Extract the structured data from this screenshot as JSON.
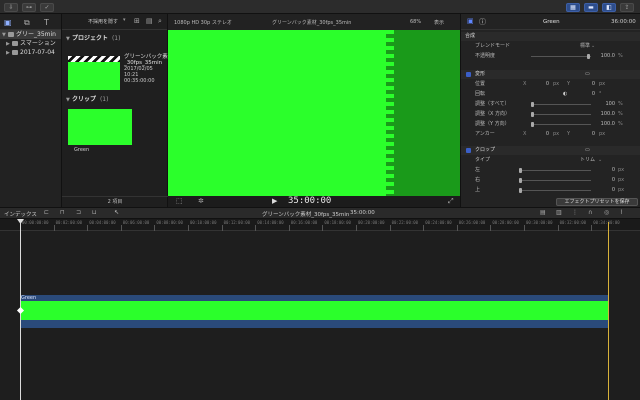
{
  "library": {
    "items": [
      {
        "label": "グリー_35min",
        "selected": true
      },
      {
        "label": "スマーション",
        "selected": false
      },
      {
        "label": "2017-07-04",
        "selected": false
      }
    ]
  },
  "browser": {
    "filter_label": "不採用を隠す",
    "project_section": {
      "title": "プロジェクト",
      "count": "(1)"
    },
    "project": {
      "name": "グリーンバック素_30fps_35min",
      "date": "2017/02/05 10:21",
      "duration": "00:35:00:00"
    },
    "clip_section": {
      "title": "クリップ",
      "count": "(1)"
    },
    "clip_name": "Green",
    "footer": "2 項目"
  },
  "viewer": {
    "format": "1080p HD 30p ステレオ",
    "project_name": "グリーンバック素材_30fps_35min",
    "zoom": "68%",
    "view_menu": "表示",
    "timecode": "35:00:00"
  },
  "inspector": {
    "title": "Green",
    "duration": "36:00:00",
    "sections": {
      "compositing": "合成",
      "blend_mode_label": "ブレンドモード",
      "blend_mode_value": "標準",
      "opacity_label": "不透明度",
      "opacity_value": "100.0",
      "opacity_unit": "%",
      "transform": "変形",
      "position_label": "位置",
      "x_label": "X",
      "y_label": "Y",
      "position_x": "0",
      "position_y": "0",
      "px": "px",
      "rotation_label": "回転",
      "rotation_value": "0",
      "deg": "°",
      "scale_all_label": "調整（すべて）",
      "scale_all_value": "100",
      "scale_x_label": "調整（X 方向）",
      "scale_x_value": "100.0",
      "scale_y_label": "調整（Y 方向）",
      "scale_y_value": "100.0",
      "pct": "%",
      "anchor_label": "アンカー",
      "anchor_x": "0",
      "anchor_y": "0",
      "crop": "クロップ",
      "type_label": "タイプ",
      "type_value": "トリム",
      "left_label": "左",
      "right_label": "右",
      "top_label": "上",
      "left_value": "0",
      "right_value": "0",
      "top_value": "0"
    },
    "save_preset": "エフェクトプリセットを保存"
  },
  "timeline": {
    "index_label": "インデックス",
    "project_name": "グリーンバック素材_30fps_35min",
    "duration": "35:00:00",
    "clip_name": "Green",
    "ruler_labels": [
      "00:00:00:00",
      "00:02:00:00",
      "00:04:00:00",
      "00:06:00:00",
      "00:08:00:00",
      "00:10:00:00",
      "00:12:00:00",
      "00:14:00:00",
      "00:16:00:00",
      "00:18:00:00",
      "00:20:00:00",
      "00:22:00:00",
      "00:24:00:00",
      "00:26:00:00",
      "00:28:00:00",
      "00:30:00:00",
      "00:32:00:00",
      "00:34:00:00"
    ]
  },
  "colors": {
    "chroma_green": "#2bff2b",
    "clip_blue": "#2a4a7a",
    "accent": "#3b5fc7"
  }
}
